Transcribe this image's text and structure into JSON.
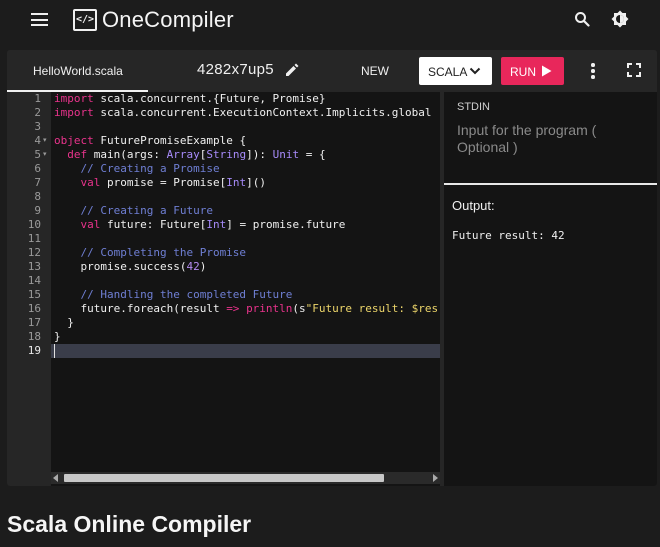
{
  "nav": {
    "logo_symbol": "</>",
    "logo_text": "OneCompiler",
    "icons": [
      "menu-icon",
      "search-icon",
      "theme-toggle-icon"
    ]
  },
  "toolbar": {
    "file_tab": "HelloWorld.scala",
    "session_id": "4282x7up5",
    "new_label": "NEW",
    "language_label": "SCALA",
    "run_label": "RUN"
  },
  "editor": {
    "line_numbers": [
      "1",
      "2",
      "3",
      "4",
      "5",
      "6",
      "7",
      "8",
      "9",
      "10",
      "11",
      "12",
      "13",
      "14",
      "15",
      "16",
      "17",
      "18",
      "19"
    ],
    "active_line": 19,
    "fold_markers_on_lines": [
      4,
      5
    ],
    "lines": [
      [
        {
          "t": "import",
          "c": "kw"
        },
        {
          "t": " scala.concurrent.{Future, Promise}",
          "c": "plain"
        }
      ],
      [
        {
          "t": "import",
          "c": "kw"
        },
        {
          "t": " scala.concurrent.ExecutionContext.Implicits.global",
          "c": "plain"
        }
      ],
      [],
      [
        {
          "t": "object",
          "c": "kw"
        },
        {
          "t": " FuturePromiseExample {",
          "c": "plain"
        }
      ],
      [
        {
          "t": "  ",
          "c": "plain"
        },
        {
          "t": "def",
          "c": "kw"
        },
        {
          "t": " main(args: ",
          "c": "plain"
        },
        {
          "t": "Array",
          "c": "type"
        },
        {
          "t": "[",
          "c": "plain"
        },
        {
          "t": "String",
          "c": "type"
        },
        {
          "t": "]): ",
          "c": "plain"
        },
        {
          "t": "Unit",
          "c": "type"
        },
        {
          "t": " = {",
          "c": "plain"
        }
      ],
      [
        {
          "t": "    // Creating a Promise",
          "c": "comment"
        }
      ],
      [
        {
          "t": "    ",
          "c": "plain"
        },
        {
          "t": "val",
          "c": "kw"
        },
        {
          "t": " promise = Promise[",
          "c": "plain"
        },
        {
          "t": "Int",
          "c": "type"
        },
        {
          "t": "]()",
          "c": "plain"
        }
      ],
      [],
      [
        {
          "t": "    // Creating a Future",
          "c": "comment"
        }
      ],
      [
        {
          "t": "    ",
          "c": "plain"
        },
        {
          "t": "val",
          "c": "kw"
        },
        {
          "t": " future: Future[",
          "c": "plain"
        },
        {
          "t": "Int",
          "c": "type"
        },
        {
          "t": "] = promise.future",
          "c": "plain"
        }
      ],
      [],
      [
        {
          "t": "    // Completing the Promise",
          "c": "comment"
        }
      ],
      [
        {
          "t": "    promise.success(",
          "c": "plain"
        },
        {
          "t": "42",
          "c": "num"
        },
        {
          "t": ")",
          "c": "plain"
        }
      ],
      [],
      [
        {
          "t": "    // Handling the completed Future",
          "c": "comment"
        }
      ],
      [
        {
          "t": "    future.foreach(result ",
          "c": "plain"
        },
        {
          "t": "=>",
          "c": "kw"
        },
        {
          "t": " ",
          "c": "plain"
        },
        {
          "t": "println",
          "c": "kw"
        },
        {
          "t": "(s",
          "c": "plain"
        },
        {
          "t": "\"Future result: $res",
          "c": "str"
        }
      ],
      [
        {
          "t": "  }",
          "c": "plain"
        }
      ],
      [
        {
          "t": "}",
          "c": "plain"
        }
      ],
      []
    ]
  },
  "stdin": {
    "label": "STDIN",
    "placeholder": "Input for the program ( Optional )"
  },
  "output": {
    "label": "Output:",
    "text": "Future result: 42"
  },
  "page_heading": "Scala Online Compiler",
  "colors": {
    "kw": "#e9338c",
    "type": "#a78bfa",
    "comment": "#6f7fd4",
    "num": "#b48cf0",
    "str": "#ecd56a",
    "plain": "#f0f0f0",
    "run_button": "#e8275b"
  }
}
